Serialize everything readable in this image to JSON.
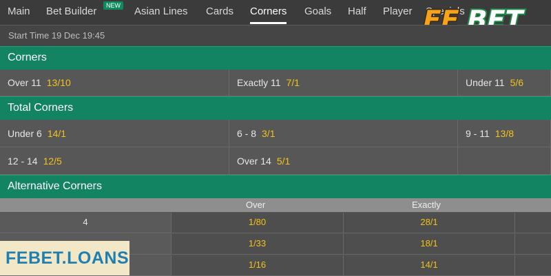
{
  "nav": {
    "tabs": [
      {
        "label": "Main"
      },
      {
        "label": "Bet Builder",
        "badge": "NEW"
      },
      {
        "label": "Asian Lines"
      },
      {
        "label": "Cards"
      },
      {
        "label": "Corners",
        "active": true
      },
      {
        "label": "Goals"
      },
      {
        "label": "Half"
      },
      {
        "label": "Player"
      },
      {
        "label": "Specials"
      }
    ]
  },
  "logo": {
    "text_fe": "FE",
    "text_bet": "BET"
  },
  "start_time": "Start Time 19 Dec 19:45",
  "corners": {
    "title": "Corners",
    "items": [
      {
        "label": "Over  11",
        "odds": "13/10"
      },
      {
        "label": "Exactly  11",
        "odds": "7/1"
      },
      {
        "label": "Under  11",
        "odds": "5/6"
      }
    ]
  },
  "total_corners": {
    "title": "Total Corners",
    "rows": [
      [
        {
          "label": "Under 6",
          "odds": "14/1"
        },
        {
          "label": "6 - 8",
          "odds": "3/1"
        },
        {
          "label": "9 - 11",
          "odds": "13/8"
        }
      ],
      [
        {
          "label": "12 - 14",
          "odds": "12/5"
        },
        {
          "label": "Over 14",
          "odds": "5/1"
        }
      ]
    ]
  },
  "alternative_corners": {
    "title": "Alternative Corners",
    "headers": {
      "over": "Over",
      "exactly": "Exactly"
    },
    "rows": [
      {
        "line": "4",
        "over": "1/80",
        "exactly": "28/1"
      },
      {
        "line": "",
        "over": "1/33",
        "exactly": "18/1"
      },
      {
        "line": "",
        "over": "1/16",
        "exactly": "14/1"
      }
    ]
  },
  "watermark": "FEBET.LOANS",
  "colors": {
    "accent_green": "#138461",
    "odds_yellow": "#f5c218",
    "logo_orange": "#f6a21b",
    "logo_green": "#1f8c4a"
  }
}
